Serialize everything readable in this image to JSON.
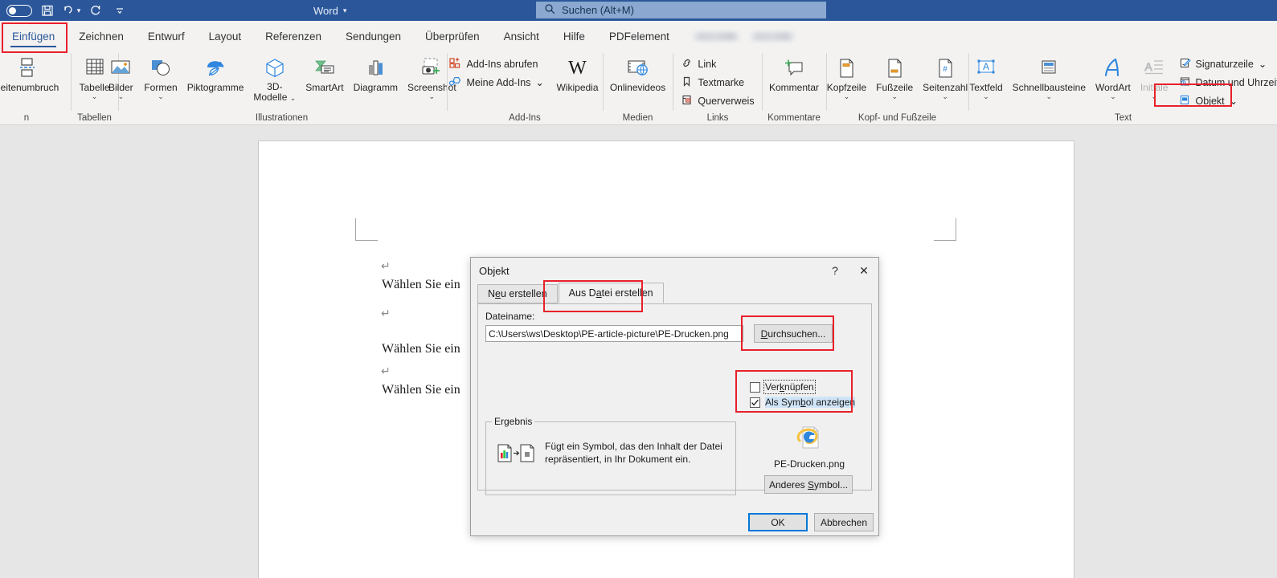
{
  "titlebar": {
    "autosave_name": "autosave-toggle",
    "save_name": "save-icon",
    "undo_name": "undo-icon",
    "redo_name": "redo-icon",
    "customize_name": "customize-quick-access-icon",
    "app_menu_label": "Word",
    "search_placeholder": "Suchen (Alt+M)",
    "accent_color": "#2b579a"
  },
  "tabs": [
    {
      "label": "Einfügen",
      "active": true
    },
    {
      "label": "Zeichnen",
      "active": false
    },
    {
      "label": "Entwurf",
      "active": false
    },
    {
      "label": "Layout",
      "active": false
    },
    {
      "label": "Referenzen",
      "active": false
    },
    {
      "label": "Sendungen",
      "active": false
    },
    {
      "label": "Überprüfen",
      "active": false
    },
    {
      "label": "Ansicht",
      "active": false
    },
    {
      "label": "Hilfe",
      "active": false
    },
    {
      "label": "PDFelement",
      "active": false
    }
  ],
  "ribbon": {
    "groups": [
      {
        "label": "",
        "items": [
          {
            "label": "Seitenumbruch",
            "icon": "page-break-icon"
          }
        ]
      },
      {
        "label": "Tabellen",
        "items": [
          {
            "label": "Tabelle",
            "icon": "table-icon",
            "chevron": "⌄"
          }
        ]
      },
      {
        "label": "Illustrationen",
        "items": [
          {
            "label": "Bilder",
            "icon": "pictures-icon",
            "chevron": "⌄"
          },
          {
            "label": "Formen",
            "icon": "shapes-icon",
            "chevron": "⌄"
          },
          {
            "label": "Piktogramme",
            "icon": "icons-icon"
          },
          {
            "label": "3D-Modelle",
            "icon": "3d-model-icon",
            "chevron": "⌄"
          },
          {
            "label": "SmartArt",
            "icon": "smartart-icon"
          },
          {
            "label": "Diagramm",
            "icon": "chart-icon"
          },
          {
            "label": "Screenshot",
            "icon": "screenshot-icon",
            "chevron": "⌄"
          }
        ]
      },
      {
        "label": "Add-Ins",
        "items": [
          {
            "label": "Add-Ins abrufen",
            "icon": "get-addins-icon"
          },
          {
            "label": "Meine Add-Ins",
            "icon": "my-addins-icon",
            "chevron": "⌄"
          },
          {
            "label": "Wikipedia",
            "icon": "wikipedia-icon"
          }
        ]
      },
      {
        "label": "Medien",
        "items": [
          {
            "label": "Onlinevideos",
            "icon": "online-video-icon"
          }
        ]
      },
      {
        "label": "Links",
        "items": [
          {
            "label": "Link",
            "icon": "link-icon"
          },
          {
            "label": "Textmarke",
            "icon": "bookmark-icon"
          },
          {
            "label": "Querverweis",
            "icon": "cross-reference-icon"
          }
        ]
      },
      {
        "label": "Kommentare",
        "items": [
          {
            "label": "Kommentar",
            "icon": "new-comment-icon"
          }
        ]
      },
      {
        "label": "Kopf- und Fußzeile",
        "items": [
          {
            "label": "Kopfzeile",
            "icon": "header-icon",
            "chevron": "⌄"
          },
          {
            "label": "Fußzeile",
            "icon": "footer-icon",
            "chevron": "⌄"
          },
          {
            "label": "Seitenzahl",
            "icon": "page-number-icon",
            "chevron": "⌄"
          }
        ]
      },
      {
        "label": "Text",
        "items": [
          {
            "label": "Textfeld",
            "icon": "text-box-icon",
            "chevron": "⌄"
          },
          {
            "label": "Schnellbausteine",
            "icon": "quick-parts-icon",
            "chevron": "⌄"
          },
          {
            "label": "WordArt",
            "icon": "wordart-icon",
            "chevron": "⌄"
          },
          {
            "label": "Initiale",
            "icon": "drop-cap-icon",
            "chevron": "⌄",
            "disabled": true
          },
          {
            "label": "Signaturzeile",
            "icon": "signature-line-icon",
            "chevron": "⌄"
          },
          {
            "label": "Datum und Uhrzeit",
            "icon": "date-time-icon"
          },
          {
            "label": "Objekt",
            "icon": "object-icon",
            "chevron": "⌄"
          }
        ]
      }
    ]
  },
  "document": {
    "lines": [
      "Wählen Sie ein",
      "Wählen Sie ein",
      "Wählen Sie ein"
    ],
    "pilcrow": "↵"
  },
  "dialog": {
    "title": "Objekt",
    "help_glyph": "?",
    "close_glyph": "✕",
    "tabs": [
      {
        "label": "Neu erstellen",
        "active": false
      },
      {
        "label": "Aus Datei erstellen",
        "active": true
      }
    ],
    "filename_label": "Dateiname:",
    "filename_value": "C:\\Users\\ws\\Desktop\\PE-article-picture\\PE-Drucken.png",
    "browse_button": "Durchsuchen...",
    "link_checkbox": {
      "label": "Verknüpfen",
      "checked": false
    },
    "icon_checkbox": {
      "label": "Als Symbol anzeigen",
      "checked": true
    },
    "result_group_title": "Ergebnis",
    "result_text": "Fügt ein Symbol, das den Inhalt der Datei repräsentiert, in Ihr Dokument ein.",
    "icon_preview_label": "PE-Drucken.png",
    "change_icon_button": "Anderes Symbol...",
    "ok_button": "OK",
    "cancel_button": "Abbrechen"
  },
  "annotations": {
    "color": "#e8202a",
    "boxes": [
      "einfuegen-tab",
      "objekt-button",
      "aus-datei-tab",
      "durchsuchen-button",
      "checkbox-group"
    ]
  }
}
